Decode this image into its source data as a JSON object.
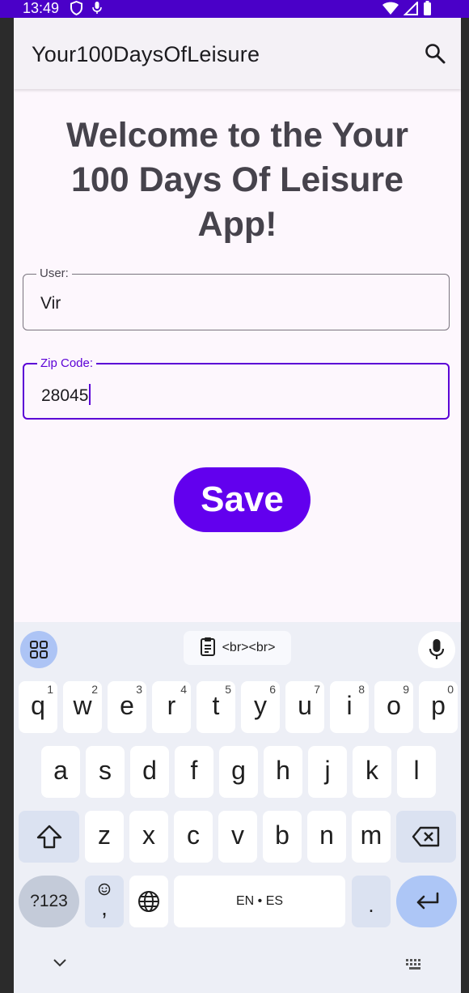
{
  "status_bar": {
    "time": "13:49",
    "left_icons": [
      "shield-icon",
      "mic-icon"
    ],
    "right_icons": [
      "wifi-icon",
      "signal-icon",
      "battery-icon"
    ]
  },
  "app_bar": {
    "title": "Your100DaysOfLeisure",
    "action_icon": "search-icon"
  },
  "main": {
    "welcome_lines": [
      "Welcome to the Your",
      "100 Days Of Leisure",
      "App!"
    ],
    "user_field": {
      "label": "User:",
      "value": "Vir"
    },
    "zip_field": {
      "label": "Zip Code:",
      "value": "28045"
    },
    "save_label": "Save"
  },
  "keyboard": {
    "clipboard_suggestion": "<br><br>",
    "row1": [
      {
        "key": "q",
        "hint": "1"
      },
      {
        "key": "w",
        "hint": "2"
      },
      {
        "key": "e",
        "hint": "3"
      },
      {
        "key": "r",
        "hint": "4"
      },
      {
        "key": "t",
        "hint": "5"
      },
      {
        "key": "y",
        "hint": "6"
      },
      {
        "key": "u",
        "hint": "7"
      },
      {
        "key": "i",
        "hint": "8"
      },
      {
        "key": "o",
        "hint": "9"
      },
      {
        "key": "p",
        "hint": "0"
      }
    ],
    "row2": [
      "a",
      "s",
      "d",
      "f",
      "g",
      "h",
      "j",
      "k",
      "l"
    ],
    "row3": [
      "z",
      "x",
      "c",
      "v",
      "b",
      "n",
      "m"
    ],
    "symbols_label": "?123",
    "emoji_comma_label": ",",
    "space_label": "EN • ES",
    "period_label": ".",
    "colors": {
      "keyboard_bg": "#edeff6",
      "enter": "#adc6f6",
      "accent": "#6200ee"
    }
  }
}
